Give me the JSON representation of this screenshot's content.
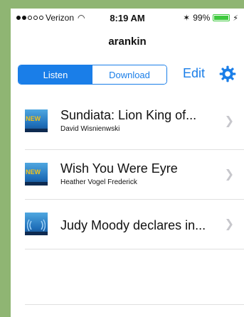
{
  "status_bar": {
    "carrier": "Verizon",
    "time": "8:19 AM",
    "battery_percent": "99%",
    "battery_level": 0.99,
    "signal_filled": 2,
    "signal_total": 5
  },
  "nav": {
    "title": "arankin"
  },
  "segmented": {
    "options": [
      "Listen",
      "Download"
    ],
    "selected": "Listen"
  },
  "toolbar": {
    "edit_label": "Edit",
    "settings_icon": "gear-icon"
  },
  "books": [
    {
      "title": "Sundiata:  Lion King of...",
      "author": "David Wisnienwski",
      "badge": "NEW"
    },
    {
      "title": "Wish You Were Eyre",
      "author": "Heather Vogel Frederick",
      "badge": "NEW"
    },
    {
      "title": "Judy Moody declares in...",
      "author": "",
      "badge": ""
    }
  ],
  "colors": {
    "accent": "#1a7ee8",
    "background": "#8fb573",
    "battery": "#3ec93e",
    "badge": "#f2c21b"
  }
}
